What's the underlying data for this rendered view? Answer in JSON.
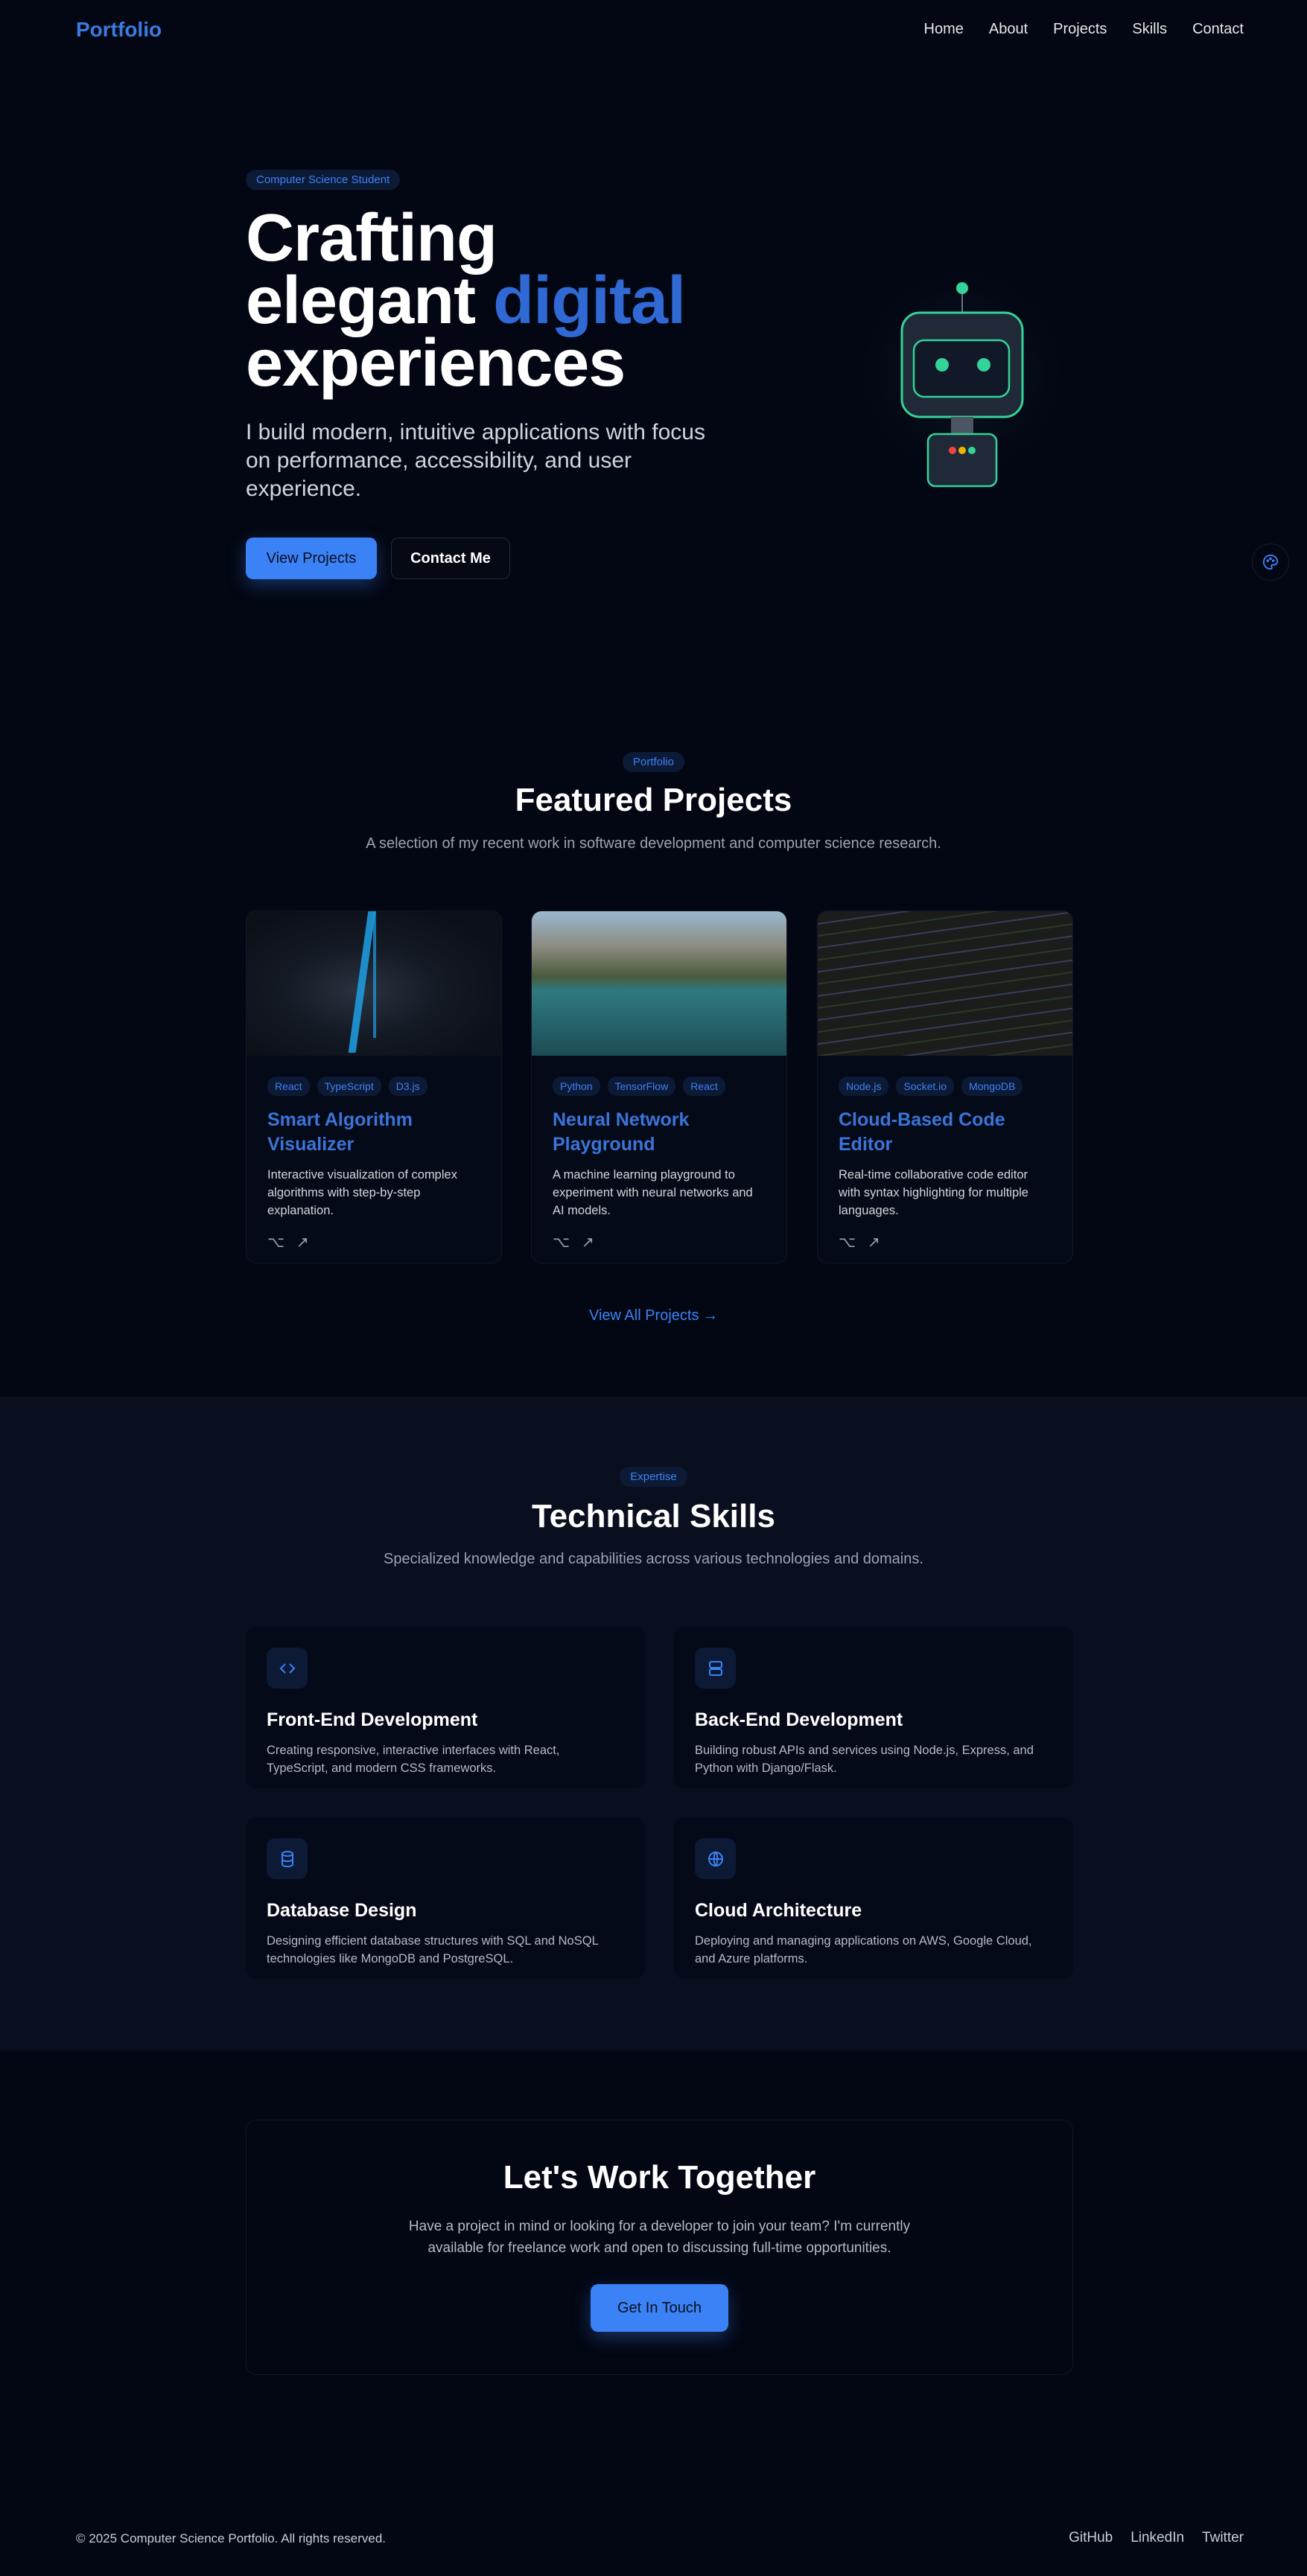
{
  "nav": {
    "logo": "Portfolio",
    "links": [
      "Home",
      "About",
      "Projects",
      "Skills",
      "Contact"
    ]
  },
  "hero": {
    "badge": "Computer Science Student",
    "title_line1": "Crafting",
    "title_line2a": "elegant ",
    "title_line2b": "digital",
    "title_line3": "experiences",
    "subtitle": "I build modern, intuitive applications with focus on performance, accessibility, and user experience.",
    "primary_button": "View Projects",
    "secondary_button": "Contact Me"
  },
  "projects": {
    "badge": "Portfolio",
    "title": "Featured Projects",
    "subtitle": "A selection of my recent work in software development and computer science research.",
    "view_all": "View All Projects →",
    "items": [
      {
        "tags": [
          "React",
          "TypeScript",
          "D3.js"
        ],
        "title": "Smart Algorithm Visualizer",
        "description": "Interactive visualization of complex algorithms with step-by-step explanation."
      },
      {
        "tags": [
          "Python",
          "TensorFlow",
          "React"
        ],
        "title": "Neural Network Playground",
        "description": "A machine learning playground to experiment with neural networks and AI models."
      },
      {
        "tags": [
          "Node.js",
          "Socket.io",
          "MongoDB"
        ],
        "title": "Cloud-Based Code Editor",
        "description": "Real-time collaborative code editor with syntax highlighting for multiple languages."
      }
    ]
  },
  "skills": {
    "badge": "Expertise",
    "title": "Technical Skills",
    "subtitle": "Specialized knowledge and capabilities across various technologies and domains.",
    "items": [
      {
        "icon": "code-icon",
        "title": "Front-End Development",
        "description": "Creating responsive, interactive interfaces with React, TypeScript, and modern CSS frameworks."
      },
      {
        "icon": "server-icon",
        "title": "Back-End Development",
        "description": "Building robust APIs and services using Node.js, Express, and Python with Django/Flask."
      },
      {
        "icon": "database-icon",
        "title": "Database Design",
        "description": "Designing efficient database structures with SQL and NoSQL technologies like MongoDB and PostgreSQL."
      },
      {
        "icon": "globe-icon",
        "title": "Cloud Architecture",
        "description": "Deploying and managing applications on AWS, Google Cloud, and Azure platforms."
      }
    ]
  },
  "cta": {
    "title": "Let's Work Together",
    "text": "Have a project in mind or looking for a developer to join your team? I'm currently available for freelance work and open to discussing full-time opportunities.",
    "button": "Get In Touch"
  },
  "footer": {
    "copyright": "© 2025 Computer Science Portfolio. All rights reserved.",
    "links": [
      "GitHub",
      "LinkedIn",
      "Twitter"
    ]
  },
  "colors": {
    "accent": "#3b82f6",
    "robot": "#34d399",
    "background": "#030713"
  }
}
